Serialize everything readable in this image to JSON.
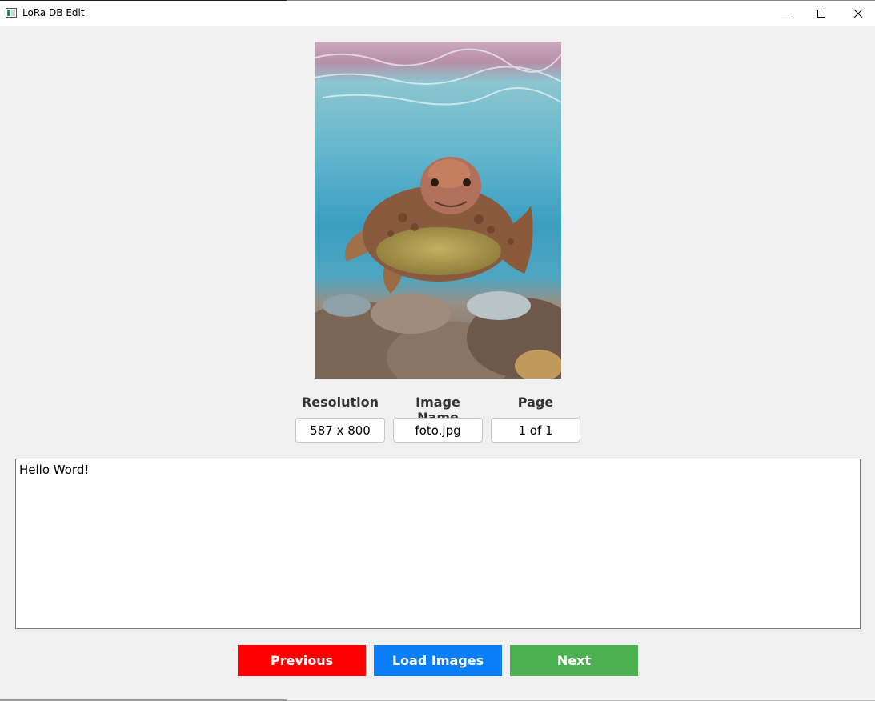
{
  "window": {
    "title": "LoRa DB Edit"
  },
  "info": {
    "resolution_label": "Resolution",
    "resolution_value": "587 x 800",
    "image_name_label": "Image Name",
    "image_name_value": "foto.jpg",
    "page_label": "Page",
    "page_value": "1 of 1"
  },
  "caption": {
    "text": "Hello Word!"
  },
  "buttons": {
    "previous": "Previous",
    "load": "Load Images",
    "next": "Next"
  },
  "colors": {
    "previous": "#ff0000",
    "load": "#0a7ef7",
    "next": "#4caf50"
  }
}
